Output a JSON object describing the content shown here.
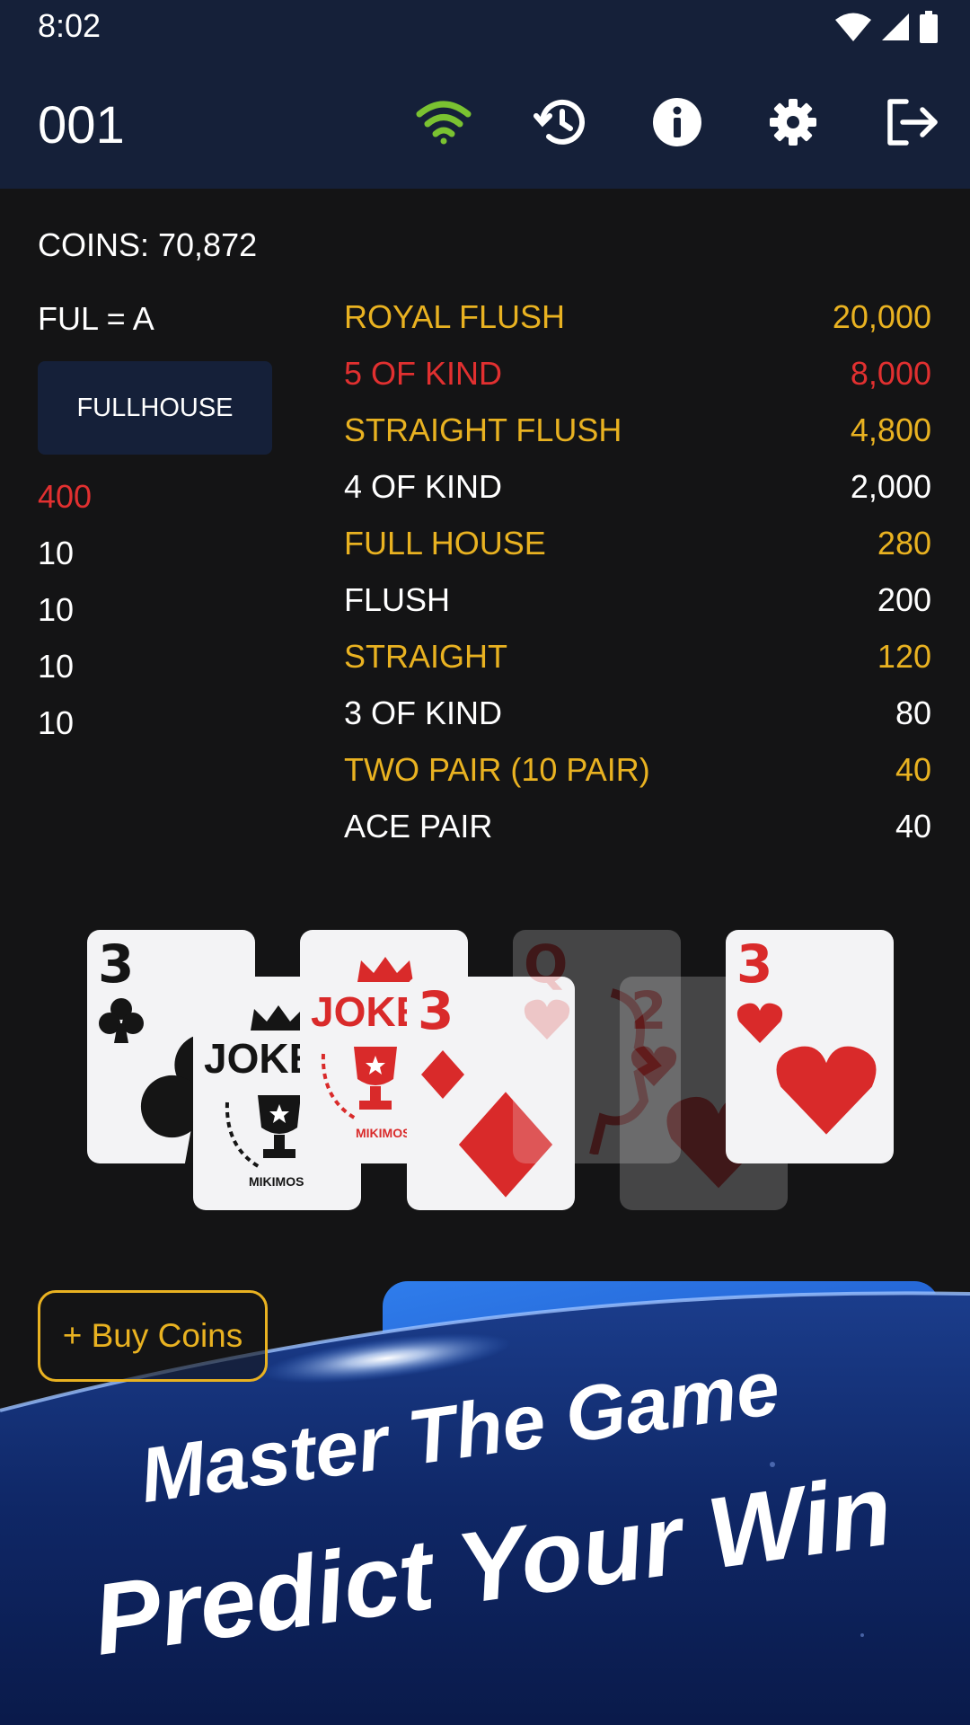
{
  "status_bar": {
    "time": "8:02"
  },
  "app_bar": {
    "title": "001",
    "icons": [
      "wifi-icon",
      "history-icon",
      "info-icon",
      "settings-gear-icon",
      "logout-icon"
    ],
    "wifi_color": "#7ac231"
  },
  "coins": {
    "label": "COINS: 70,872"
  },
  "hold": {
    "label": "FUL = A",
    "button_label": "FULLHOUSE",
    "values": [
      {
        "text": "400",
        "color": "red"
      },
      {
        "text": "10",
        "color": "white"
      },
      {
        "text": "10",
        "color": "white"
      },
      {
        "text": "10",
        "color": "white"
      },
      {
        "text": "10",
        "color": "white"
      }
    ]
  },
  "paytable": [
    {
      "name": "ROYAL FLUSH",
      "amount": "20,000",
      "color": "gold"
    },
    {
      "name": "5 OF KIND",
      "amount": "8,000",
      "color": "red"
    },
    {
      "name": "STRAIGHT FLUSH",
      "amount": "4,800",
      "color": "gold"
    },
    {
      "name": "4 OF KIND",
      "amount": "2,000",
      "color": "white"
    },
    {
      "name": "FULL HOUSE",
      "amount": "280",
      "color": "gold"
    },
    {
      "name": "FLUSH",
      "amount": "200",
      "color": "white"
    },
    {
      "name": "STRAIGHT",
      "amount": "120",
      "color": "gold"
    },
    {
      "name": "3 OF KIND",
      "amount": "80",
      "color": "white"
    },
    {
      "name": "TWO PAIR (10 PAIR)",
      "amount": "40",
      "color": "gold"
    },
    {
      "name": "ACE PAIR",
      "amount": "40",
      "color": "white"
    }
  ],
  "cards": [
    {
      "rank": "3",
      "suit": "clubs",
      "faded": false
    },
    {
      "rank": "JOKER",
      "suit": "joker-black",
      "brand": "MIKIMOS",
      "faded": false
    },
    {
      "rank": "JOKER",
      "suit": "joker-red",
      "brand": "MIKIMOS",
      "faded": false
    },
    {
      "rank": "3",
      "suit": "diamonds",
      "faded": false
    },
    {
      "rank": "Q",
      "suit": "hearts",
      "faded": true
    },
    {
      "rank": "2",
      "suit": "hearts",
      "faded": true
    },
    {
      "rank": "3",
      "suit": "hearts",
      "faded": false
    }
  ],
  "colors": {
    "gold": "#e9b221",
    "red": "#e13030",
    "bar": "#152039",
    "background": "#141415"
  },
  "buy_coins_label": "+ Buy Coins",
  "banner": {
    "line1": "Master The Game",
    "line2": "Predict Your Win"
  }
}
